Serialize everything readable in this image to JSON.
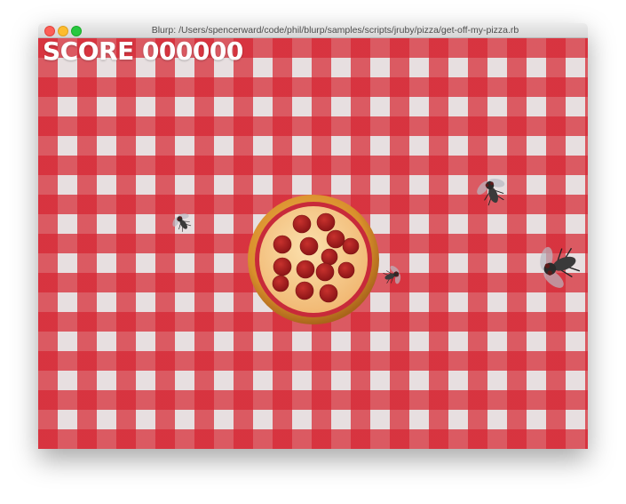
{
  "window": {
    "title": "Blurp: /Users/spencerward/code/phil/blurp/samples/scripts/jruby/pizza/get-off-my-pizza.rb"
  },
  "hud": {
    "score_text": "SCORE 000000"
  },
  "colors": {
    "tablecloth_red": "#d62632",
    "tablecloth_white": "#e7dfe0",
    "score_text": "#ffffff",
    "pizza_crust": "#d9932f",
    "pizza_cheese": "#f4c98a",
    "pepperoni": "#a81c1e"
  },
  "icons": {
    "pizza": "pizza-icon",
    "fly": "fly-icon"
  }
}
